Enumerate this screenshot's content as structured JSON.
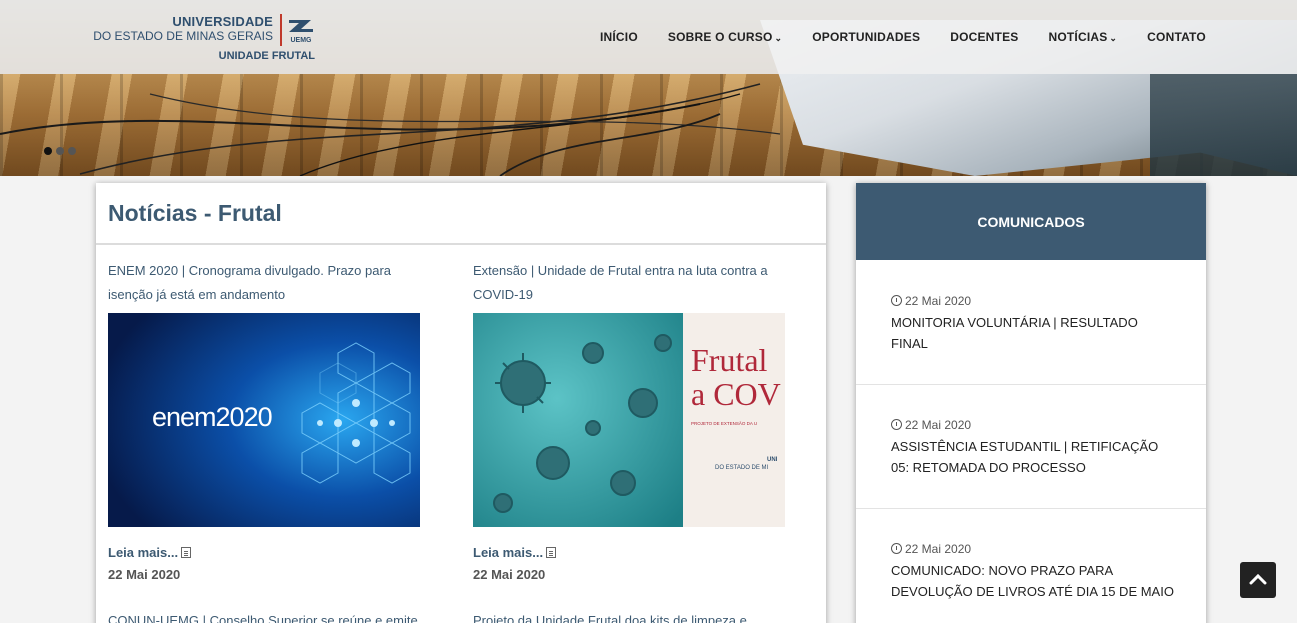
{
  "header": {
    "logo": {
      "line1": "UNIVERSIDADE",
      "line2": "DO ESTADO DE MINAS GERAIS",
      "line3": "UNIDADE FRUTAL",
      "emblem_text": "UEMG"
    },
    "nav": [
      {
        "label": "INÍCIO",
        "dropdown": false
      },
      {
        "label": "SOBRE O CURSO",
        "dropdown": true
      },
      {
        "label": "OPORTUNIDADES",
        "dropdown": false
      },
      {
        "label": "DOCENTES",
        "dropdown": false
      },
      {
        "label": "NOTÍCIAS",
        "dropdown": true
      },
      {
        "label": "CONTATO",
        "dropdown": false
      }
    ]
  },
  "carousel": {
    "active_index": 0,
    "count": 3
  },
  "main": {
    "title": "Notícias - Frutal",
    "posts": [
      {
        "title": "ENEM 2020 | Cronograma divulgado. Prazo para isenção já está em andamento",
        "image_text": "enem2020",
        "more_label": "Leia mais...",
        "date": "22 Mai 2020"
      },
      {
        "title": "Extensão | Unidade de Frutal entra na luta contra a COVID-19",
        "image_text_1": "Frutal",
        "image_text_2": "a COV",
        "image_small_1": "PROJETO DE EXTENSÃO DA U",
        "image_small_2": "UNI",
        "image_small_3": "DO ESTADO DE MI",
        "more_label": "Leia mais...",
        "date": "22 Mai 2020"
      }
    ],
    "next_titles": [
      "CONUN-UEMG | Conselho Superior se reúne e emite",
      "Projeto da Unidade Frutal doa kits de limpeza e"
    ]
  },
  "sidebar": {
    "title": "COMUNICADOS",
    "items": [
      {
        "date": "22 Mai 2020",
        "text": "MONITORIA VOLUNTÁRIA | RESULTADO FINAL"
      },
      {
        "date": "22 Mai 2020",
        "text": "ASSISTÊNCIA ESTUDANTIL | RETIFICAÇÃO 05: RETOMADA DO PROCESSO"
      },
      {
        "date": "22 Mai 2020",
        "text": "COMUNICADO: NOVO PRAZO PARA DEVOLUÇÃO DE LIVROS ATÉ DIA 15 DE MAIO"
      }
    ]
  },
  "colors": {
    "primary": "#3d5a72",
    "accent_red": "#c0392b"
  }
}
